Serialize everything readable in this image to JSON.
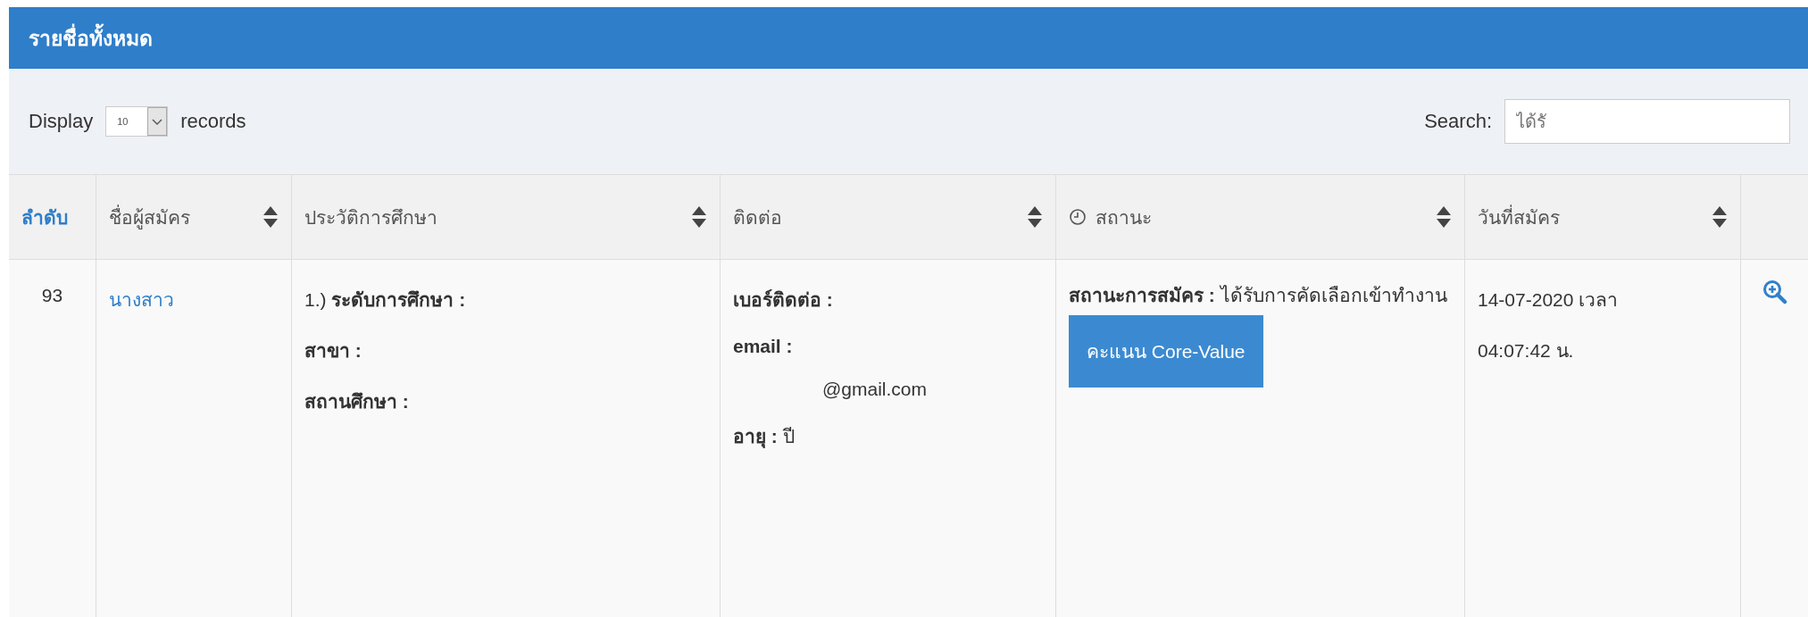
{
  "panel": {
    "title": "รายชื่อทั้งหมด"
  },
  "length_control": {
    "label": "Display",
    "value": "10",
    "suffix": "records"
  },
  "search": {
    "label": "Search:",
    "value": "ได้รั"
  },
  "table": {
    "columns": [
      {
        "label": "ลำดับ",
        "kind": "index",
        "sortable": false
      },
      {
        "label": "ชื่อผู้สมัคร",
        "kind": "text",
        "sortable": true
      },
      {
        "label": "ประวัติการศึกษา",
        "kind": "text",
        "sortable": true
      },
      {
        "label": "ติดต่อ",
        "kind": "text",
        "sortable": true
      },
      {
        "label": "สถานะ",
        "kind": "status",
        "sortable": true
      },
      {
        "label": "วันที่สมัคร",
        "kind": "text",
        "sortable": true
      },
      {
        "kind": "action",
        "sortable": false
      }
    ],
    "rows": [
      {
        "index": "93",
        "name": "นางสาว",
        "education": [
          "1.) **ระดับการศึกษา :**",
          "**สาขา :**",
          "**สถานศึกษา :**"
        ],
        "contact": [
          "**เบอร์ติดต่อ :**",
          "**email :**",
          "@gmail.com",
          "**อายุ :**     ปี"
        ],
        "status": "**สถานะการสมัคร :** ได้รับการคัดเลือกเข้าทำงาน",
        "score_button": "คะแนน Core-Value",
        "date": [
          "14-07-2020 เวลา",
          "04:07:42 น."
        ]
      }
    ]
  }
}
